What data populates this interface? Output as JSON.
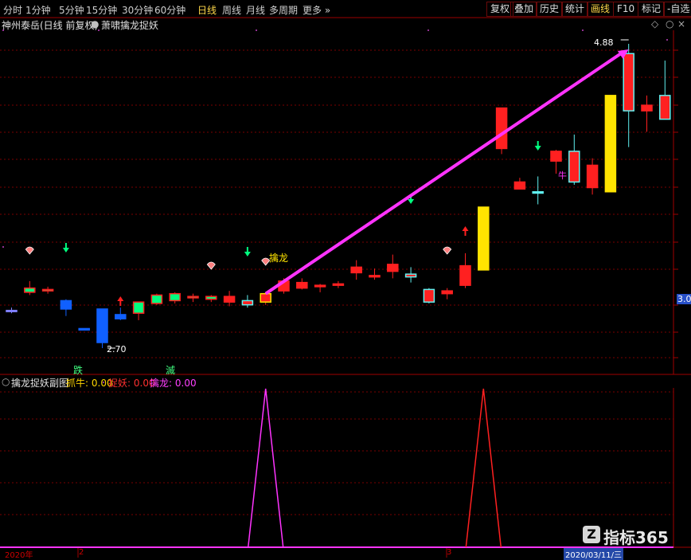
{
  "toolbar": {
    "periods": [
      {
        "label": "分时",
        "active": false
      },
      {
        "label": "1分钟",
        "active": false
      },
      {
        "label": "5分钟",
        "active": false
      },
      {
        "label": "15分钟",
        "active": false
      },
      {
        "label": "30分钟",
        "active": false
      },
      {
        "label": "60分钟",
        "active": false
      },
      {
        "label": "日线",
        "active": true
      },
      {
        "label": "周线",
        "active": false
      },
      {
        "label": "月线",
        "active": false
      },
      {
        "label": "多周期",
        "active": false
      },
      {
        "label": "更多",
        "active": false
      }
    ],
    "right_buttons": [
      {
        "label": "复权",
        "active": false
      },
      {
        "label": "叠加",
        "active": false
      },
      {
        "label": "历史",
        "active": false
      },
      {
        "label": "统计",
        "active": false
      },
      {
        "label": "画线",
        "active": true
      },
      {
        "label": "F10",
        "active": false
      },
      {
        "label": "标记",
        "active": false
      },
      {
        "label": "-自选",
        "active": false
      }
    ]
  },
  "main_chart": {
    "title": "神州泰岳(日线 前复权)",
    "indicator_name": "萧啸擒龙捉妖",
    "high_label": "4.88",
    "low_label": "2.70",
    "price_tag": "3.00",
    "signal_label": "擒龙",
    "char_die": "跌",
    "char_mie": "滅",
    "char_niu": "牛"
  },
  "sub_chart": {
    "title": "擒龙捉妖副图",
    "items": [
      {
        "name": "抓牛",
        "value": "0.00",
        "color": "#ffd700"
      },
      {
        "name": "捉妖",
        "value": "0.00",
        "color": "#ff3030"
      },
      {
        "name": "擒龙",
        "value": "0.00",
        "color": "#ff40ff"
      }
    ]
  },
  "time_axis": {
    "labels": [
      "2020年",
      "2",
      "3",
      "2020/03/11/三"
    ]
  },
  "watermark": "指标365",
  "colors": {
    "up": "#ff2020",
    "down": "#00ff7f",
    "blue": "#1060ff",
    "yellow": "#ffe400",
    "cyan": "#60f0f0",
    "magenta": "#ff33ff",
    "grid": "#7a0000"
  },
  "chart_data": {
    "type": "candlestick",
    "bars": [
      {
        "o": 2.97,
        "c": 2.97,
        "h": 2.99,
        "l": 2.95,
        "k": "cross"
      },
      {
        "o": 3.1,
        "c": 3.13,
        "h": 3.18,
        "l": 3.08,
        "k": "up_green"
      },
      {
        "o": 3.12,
        "c": 3.11,
        "h": 3.14,
        "l": 3.09,
        "k": "up_green"
      },
      {
        "o": 2.98,
        "c": 3.04,
        "h": 3.05,
        "l": 2.93,
        "k": "blue"
      },
      {
        "o": 2.83,
        "c": 2.84,
        "h": 2.84,
        "l": 2.83,
        "k": "cross_blue"
      },
      {
        "o": 2.74,
        "c": 2.98,
        "h": 2.98,
        "l": 2.7,
        "k": "blue"
      },
      {
        "o": 2.91,
        "c": 2.94,
        "h": 2.99,
        "l": 2.9,
        "k": "blue"
      },
      {
        "o": 2.95,
        "c": 3.03,
        "h": 3.03,
        "l": 2.9,
        "k": "up_green"
      },
      {
        "o": 3.02,
        "c": 3.08,
        "h": 3.09,
        "l": 3.01,
        "k": "up_green"
      },
      {
        "o": 3.04,
        "c": 3.09,
        "h": 3.1,
        "l": 3.02,
        "k": "up_green"
      },
      {
        "o": 3.07,
        "c": 3.06,
        "h": 3.09,
        "l": 3.03,
        "k": "up_green"
      },
      {
        "o": 3.05,
        "c": 3.07,
        "h": 3.08,
        "l": 3.03,
        "k": "up_green"
      },
      {
        "o": 3.07,
        "c": 3.03,
        "h": 3.11,
        "l": 3.0,
        "k": "red"
      },
      {
        "o": 3.04,
        "c": 3.01,
        "h": 3.08,
        "l": 2.99,
        "k": "cyan_red"
      },
      {
        "o": 3.03,
        "c": 3.09,
        "h": 3.1,
        "l": 3.01,
        "k": "yellow_red"
      },
      {
        "o": 3.11,
        "c": 3.18,
        "h": 3.2,
        "l": 3.09,
        "k": "red"
      },
      {
        "o": 3.13,
        "c": 3.17,
        "h": 3.2,
        "l": 3.12,
        "k": "red"
      },
      {
        "o": 3.15,
        "c": 3.14,
        "h": 3.16,
        "l": 3.1,
        "k": "cross_red"
      },
      {
        "o": 3.16,
        "c": 3.15,
        "h": 3.18,
        "l": 3.13,
        "k": "red"
      },
      {
        "o": 3.24,
        "c": 3.28,
        "h": 3.33,
        "l": 3.19,
        "k": "red"
      },
      {
        "o": 3.22,
        "c": 3.21,
        "h": 3.27,
        "l": 3.19,
        "k": "cross_red"
      },
      {
        "o": 3.25,
        "c": 3.3,
        "h": 3.37,
        "l": 3.2,
        "k": "red"
      },
      {
        "o": 3.21,
        "c": 3.23,
        "h": 3.28,
        "l": 3.17,
        "k": "cyan_red"
      },
      {
        "o": 3.03,
        "c": 3.12,
        "h": 3.13,
        "l": 3.02,
        "k": "cyan_red"
      },
      {
        "o": 3.09,
        "c": 3.11,
        "h": 3.13,
        "l": 3.05,
        "k": "red"
      },
      {
        "o": 3.15,
        "c": 3.29,
        "h": 3.38,
        "l": 3.13,
        "k": "red"
      },
      {
        "o": 3.26,
        "c": 3.71,
        "h": 3.71,
        "l": 3.26,
        "k": "yellow"
      },
      {
        "o": 4.13,
        "c": 4.42,
        "h": 4.42,
        "l": 4.09,
        "k": "red"
      },
      {
        "o": 3.84,
        "c": 3.89,
        "h": 3.92,
        "l": 3.84,
        "k": "red"
      },
      {
        "o": 3.82,
        "c": 3.81,
        "h": 3.93,
        "l": 3.73,
        "k": "cross_cyan"
      },
      {
        "o": 4.04,
        "c": 4.11,
        "h": 4.12,
        "l": 3.95,
        "k": "red"
      },
      {
        "o": 3.89,
        "c": 4.11,
        "h": 4.23,
        "l": 3.87,
        "k": "cyan_red"
      },
      {
        "o": 3.85,
        "c": 4.01,
        "h": 4.06,
        "l": 3.8,
        "k": "red"
      },
      {
        "o": 3.82,
        "c": 4.51,
        "h": 4.51,
        "l": 3.82,
        "k": "yellow"
      },
      {
        "o": 4.4,
        "c": 4.81,
        "h": 4.88,
        "l": 4.14,
        "k": "cyan_red"
      },
      {
        "o": 4.4,
        "c": 4.44,
        "h": 4.51,
        "l": 4.25,
        "k": "red"
      },
      {
        "o": 4.34,
        "c": 4.51,
        "h": 4.76,
        "l": 4.34,
        "k": "cyan_red"
      }
    ],
    "trend_line": {
      "from": {
        "bar": 14,
        "price": 3.09
      },
      "to": {
        "bar": 34,
        "price": 4.84
      }
    },
    "sub_spikes": [
      {
        "bar": 14,
        "color": "magenta"
      },
      {
        "bar": 26,
        "color": "red"
      }
    ]
  }
}
